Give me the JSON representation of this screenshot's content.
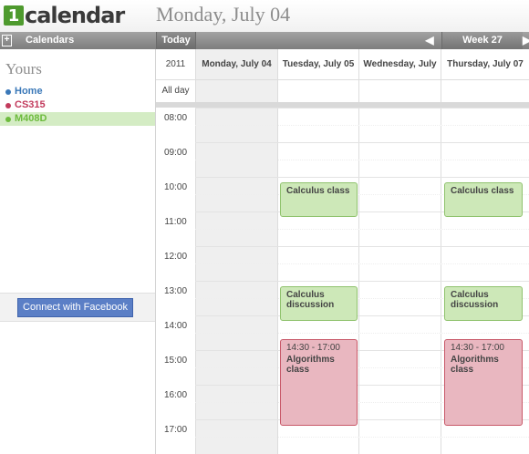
{
  "header": {
    "logo_mark": "1",
    "logo_text": "calendar",
    "date_title": "Monday, July 04"
  },
  "toolbar": {
    "toggle_icon": "+",
    "calendars_label": "Calendars",
    "today_label": "Today",
    "prev_icon": "◀",
    "week_label": "Week 27",
    "next_icon": "▶"
  },
  "sidebar": {
    "section_title": "Yours",
    "calendars": [
      {
        "label": "Home",
        "color": "#3a78b8"
      },
      {
        "label": "CS315",
        "color": "#c23a5c"
      },
      {
        "label": "M408D",
        "color": "#6dbb3d"
      }
    ],
    "facebook_button": "Connect with Facebook"
  },
  "grid": {
    "year": "2011",
    "allday_label": "All day",
    "days": [
      "Monday, July 04",
      "Tuesday, July 05",
      "Wednesday, July",
      "Thursday, July 07"
    ],
    "times": [
      "08:00",
      "09:00",
      "10:00",
      "11:00",
      "12:00",
      "13:00",
      "14:00",
      "15:00",
      "16:00",
      "17:00"
    ]
  },
  "events": [
    {
      "day": "Tuesday, July 05",
      "title": "Calculus class",
      "time": "",
      "color": "#cde8b8"
    },
    {
      "day": "Thursday, July 07",
      "title": "Calculus class",
      "time": "",
      "color": "#cde8b8"
    },
    {
      "day": "Tuesday, July 05",
      "title": "Calculus discussion",
      "time": "",
      "color": "#cde8b8"
    },
    {
      "day": "Thursday, July 07",
      "title": "Calculus discussion",
      "time": "",
      "color": "#cde8b8"
    },
    {
      "day": "Tuesday, July 05",
      "title": "Algorithms class",
      "time": "14:30 - 17:00",
      "color": "#e9b7c0"
    },
    {
      "day": "Thursday, July 07",
      "title": "Algorithms class",
      "time": "14:30 - 17:00",
      "color": "#e9b7c0"
    }
  ]
}
